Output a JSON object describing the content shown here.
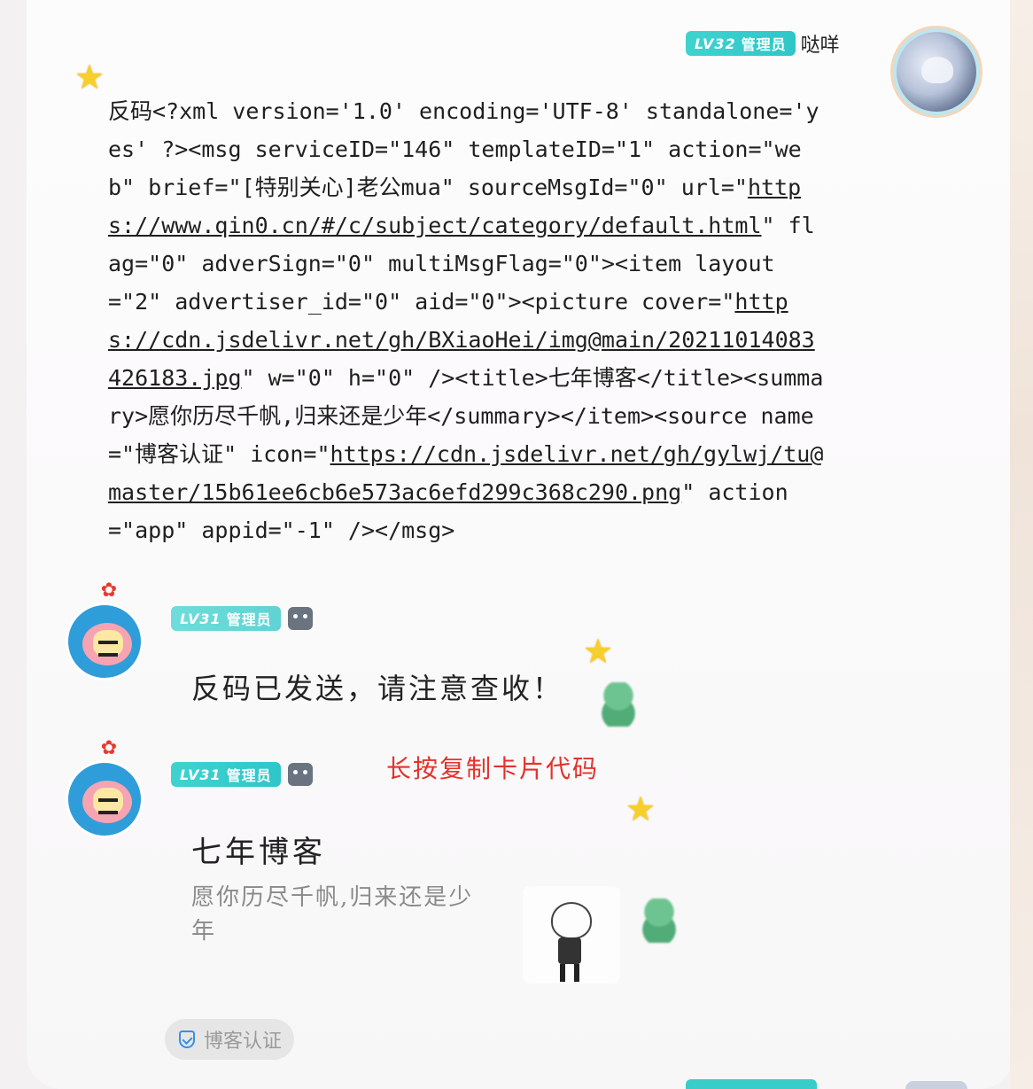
{
  "self_message": {
    "level_badge": "LV32",
    "role_badge": "管理员",
    "sender_name": "哒咩",
    "avatar_icon": "anime-avatar",
    "body_parts": [
      {
        "text": "反码<?xml version='1.0' encoding='UTF-8' standalone='yes' ?><msg serviceID=\"146\" templateID=\"1\" action=\"web\" brief=\"[特别关心]老公mua\" sourceMsgId=\"0\" url=\"",
        "link": false
      },
      {
        "text": "https://www.qin0.cn/#/c/subject/category/default.html",
        "link": true
      },
      {
        "text": "\" flag=\"0\" adverSign=\"0\" multiMsgFlag=\"0\"><item layout=\"2\" advertiser_id=\"0\" aid=\"0\"><picture cover=\"",
        "link": false
      },
      {
        "text": "https://cdn.jsdelivr.net/gh/BXiaoHei/img@main/20211014083426183.jpg",
        "link": true
      },
      {
        "text": "\" w=\"0\" h=\"0\" /><title>七年博客</title><summary>愿你历尽千帆,归来还是少年</summary></item><source name=\"博客认证\" icon=\"",
        "link": false
      },
      {
        "text": "https://cdn.jsdelivr.net/gh/gylwj/tu@master/15b61ee6cb6e573ac6efd299c368c290.png",
        "link": true
      },
      {
        "text": "\" action=\"app\" appid=\"-1\" /></msg>",
        "link": false
      }
    ]
  },
  "bot_message_1": {
    "level_badge": "LV31",
    "role_badge": "管理员",
    "text": "反码已发送，请注意查收！"
  },
  "bot_message_2": {
    "level_badge": "LV31",
    "role_badge": "管理员",
    "note": "长按复制卡片代码",
    "card": {
      "title": "七年博客",
      "summary": "愿你历尽千帆,归来还是少年",
      "source_label": "博客认证"
    }
  },
  "colors": {
    "badge": "#38cdc9",
    "note_red": "#e3322d",
    "star": "#f7cf2a",
    "shield_blue": "#3a8fde"
  }
}
